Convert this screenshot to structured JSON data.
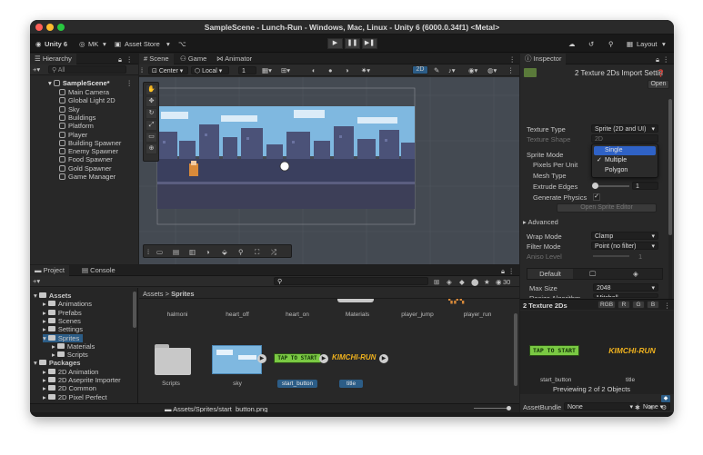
{
  "window": {
    "title": "SampleScene - Lunch-Run - Windows, Mac, Linux - Unity 6 (6000.0.34f1) <Metal>"
  },
  "toolbar": {
    "unity_label": "Unity 6",
    "account_label": "MK",
    "asset_store_label": "Asset Store",
    "layout_label": "Layout"
  },
  "hierarchy": {
    "tab_label": "Hierarchy",
    "search_placeholder": "All",
    "scene_name": "SampleScene*",
    "items": [
      "Main Camera",
      "Global Light 2D",
      "Sky",
      "Buildings",
      "Platform",
      "Player",
      "Building Spawner",
      "Enemy Spawner",
      "Food Spawner",
      "Gold Spawner",
      "Game Manager"
    ]
  },
  "scene_view": {
    "tabs": [
      "Scene",
      "Game",
      "Animator"
    ],
    "pivot_label": "Center",
    "space_label": "Local",
    "snap_value": "1",
    "mode_2d": "2D"
  },
  "inspector": {
    "tab_label": "Inspector",
    "header_title": "2 Texture 2Ds Import Settin",
    "open_label": "Open",
    "texture_type_label": "Texture Type",
    "texture_type_value": "Sprite (2D and UI)",
    "texture_shape_label": "Texture Shape",
    "texture_shape_value": "2D",
    "sprite_mode_label": "Sprite Mode",
    "ppu_label": "Pixels Per Unit",
    "mesh_type_label": "Mesh Type",
    "extrude_label": "Extrude Edges",
    "extrude_value": "1",
    "gen_physics_label": "Generate Physics",
    "open_sprite_editor": "Open Sprite Editor",
    "advanced_label": "Advanced",
    "wrap_label": "Wrap Mode",
    "wrap_value": "Clamp",
    "filter_label": "Filter Mode",
    "filter_value": "Point (no filter)",
    "aniso_label": "Aniso Level",
    "aniso_value": "1",
    "default_tab": "Default",
    "max_size_label": "Max Size",
    "max_size_value": "2048",
    "resize_label": "Resize Algorithm",
    "resize_value": "Mitchell",
    "dropdown_options": [
      {
        "label": "Single",
        "selected": false,
        "highlighted": true
      },
      {
        "label": "Multiple",
        "selected": true,
        "highlighted": false
      },
      {
        "label": "Polygon",
        "selected": false,
        "highlighted": false
      }
    ],
    "preview_title": "2 Texture 2Ds",
    "channels": [
      "RGB",
      "R",
      "G",
      "B"
    ],
    "preview_names": [
      "start_button",
      "title"
    ],
    "preview_footer": "Previewing 2 of 2 Objects",
    "assetbundle_label": "AssetBundle",
    "assetbundle_value": "None",
    "assetbundle_variant": "None"
  },
  "project": {
    "tabs": [
      "Project",
      "Console"
    ],
    "breadcrumb_root": "Assets",
    "breadcrumb_child": "Sprites",
    "hidden_count": "30",
    "tree": [
      {
        "label": "Assets",
        "depth": 0,
        "bold": true
      },
      {
        "label": "Animations",
        "depth": 1
      },
      {
        "label": "Prefabs",
        "depth": 1
      },
      {
        "label": "Scenes",
        "depth": 1
      },
      {
        "label": "Settings",
        "depth": 1
      },
      {
        "label": "Sprites",
        "depth": 1,
        "selected": true
      },
      {
        "label": "Materials",
        "depth": 2
      },
      {
        "label": "Scripts",
        "depth": 2
      },
      {
        "label": "Packages",
        "depth": 0,
        "bold": true
      },
      {
        "label": "2D Animation",
        "depth": 1
      },
      {
        "label": "2D Aseprite Importer",
        "depth": 1
      },
      {
        "label": "2D Common",
        "depth": 1
      },
      {
        "label": "2D Pixel Perfect",
        "depth": 1
      }
    ],
    "top_row_assets": [
      "halmoni",
      "heart_off",
      "heart_on",
      "Materials",
      "player_jump",
      "player_run"
    ],
    "bottom_row_assets": [
      {
        "name": "Scripts",
        "selected": false
      },
      {
        "name": "sky",
        "selected": false
      },
      {
        "name": "start_button",
        "selected": true
      },
      {
        "name": "title",
        "selected": true
      }
    ],
    "start_button_text": "TAP TO START",
    "title_text": "KIMCHI-RUN",
    "status_path": "Assets/Sprites/start_button.png"
  },
  "colors": {
    "accent_blue": "#2c5d87",
    "dropdown_highlight": "#2f62c6",
    "sky": "#7fb8e0",
    "button_green": "#7ac943",
    "title_yellow": "#f0b21e"
  }
}
